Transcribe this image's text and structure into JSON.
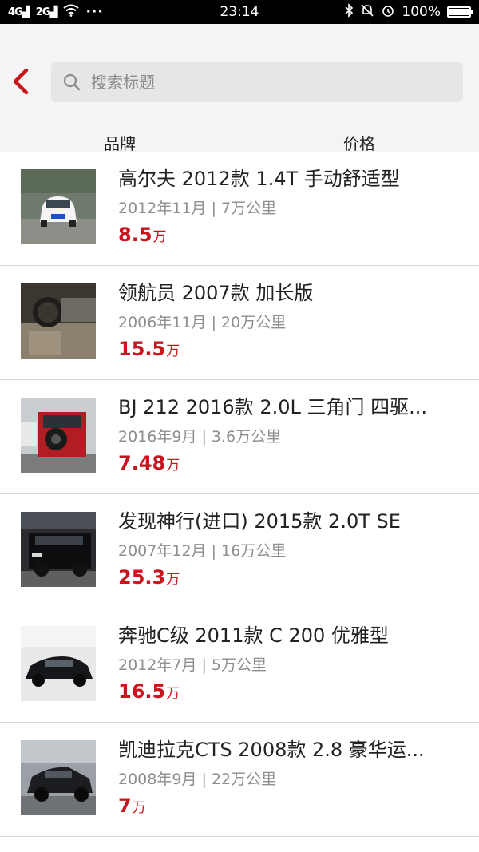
{
  "status_bar": {
    "network_left": "4G",
    "network_right": "2G",
    "more": "···",
    "time": "23:14",
    "battery": "100%",
    "battery_level": 1.0
  },
  "search": {
    "placeholder": "搜索标题"
  },
  "filters": {
    "brand": "品牌",
    "price": "价格"
  },
  "listings": [
    {
      "title": "高尔夫 2012款 1.4T 手动舒适型",
      "meta": "2012年11月 | 7万公里",
      "price": "8.5",
      "unit": "万"
    },
    {
      "title": "领航员 2007款 加长版",
      "meta": "2006年11月 | 20万公里",
      "price": "15.5",
      "unit": "万"
    },
    {
      "title": "BJ 212 2016款 2.0L 三角门 四驱...",
      "meta": "2016年9月 | 3.6万公里",
      "price": "7.48",
      "unit": "万"
    },
    {
      "title": "发现神行(进口) 2015款 2.0T SE",
      "meta": "2007年12月 | 16万公里",
      "price": "25.3",
      "unit": "万"
    },
    {
      "title": "奔驰C级 2011款 C 200 优雅型",
      "meta": "2012年7月 | 5万公里",
      "price": "16.5",
      "unit": "万"
    },
    {
      "title": "凯迪拉克CTS 2008款 2.8 豪华运...",
      "meta": "2008年9月 | 22万公里",
      "price": "7",
      "unit": "万"
    }
  ],
  "colors": {
    "accent": "#c9151e",
    "header_bg": "#f4f4f4",
    "search_bg": "#e6e6e6"
  },
  "icons": {
    "back": "chevron-left-icon",
    "search": "search-icon",
    "wifi": "wifi-icon",
    "bluetooth": "bluetooth-icon",
    "mute": "bell-off-icon",
    "alarm": "alarm-icon",
    "battery": "battery-icon"
  }
}
